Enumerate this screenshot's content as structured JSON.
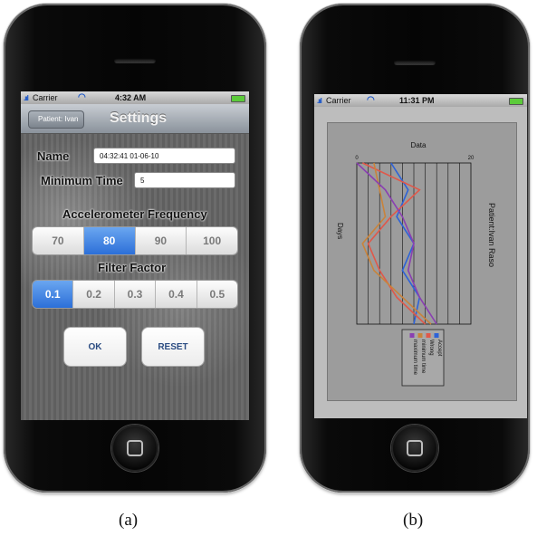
{
  "captions": {
    "a": "(a)",
    "b": "(b)"
  },
  "colors": {
    "accent": "#2c6fd8",
    "series": [
      "#2d62d8",
      "#e0584a",
      "#c9833b",
      "#8a3fb2"
    ]
  },
  "screen_a": {
    "status": {
      "carrier": "Carrier",
      "time": "4:32 AM"
    },
    "nav": {
      "back_label": "Patient: Ivan",
      "title": "Settings"
    },
    "name_label": "Name",
    "name_value": "04:32:41 01-06-10",
    "min_time_label": "Minimum Time",
    "min_time_value": "5",
    "accel_label": "Accelerometer Frequency",
    "accel_options": [
      "70",
      "80",
      "90",
      "100"
    ],
    "accel_selected": "80",
    "filter_label": "Filter Factor",
    "filter_options": [
      "0.1",
      "0.2",
      "0.3",
      "0.4",
      "0.5"
    ],
    "filter_selected": "0.1",
    "ok_label": "OK",
    "reset_label": "RESET"
  },
  "screen_b": {
    "status": {
      "carrier": "Carrier",
      "time": "11:31 PM"
    }
  },
  "chart_data": {
    "type": "line",
    "title": "Data",
    "xlabel": "Days",
    "ylabel": "",
    "right_label": "Patient:Ivan Raso",
    "xlim": [
      0,
      20
    ],
    "tick_labels": [
      "0",
      "20"
    ],
    "series": [
      {
        "name": "Accept",
        "color": "#2d62d8",
        "x": [
          6,
          9,
          7,
          10,
          8,
          11,
          10
        ],
        "y": [
          0,
          1,
          2,
          3,
          4,
          5,
          6
        ]
      },
      {
        "name": "Wrong",
        "color": "#e0584a",
        "x": [
          1,
          11,
          6,
          2,
          4,
          7,
          12
        ],
        "y": [
          0,
          1,
          2,
          3,
          4,
          5,
          6
        ]
      },
      {
        "name": "minimum time",
        "color": "#c9833b",
        "x": [
          3,
          4,
          5,
          1,
          3,
          8,
          13
        ],
        "y": [
          0,
          1,
          2,
          3,
          4,
          5,
          6
        ]
      },
      {
        "name": "maximum time",
        "color": "#8a3fb2",
        "x": [
          0,
          5,
          8,
          10,
          9,
          11,
          14
        ],
        "y": [
          0,
          1,
          2,
          3,
          4,
          5,
          6
        ]
      }
    ]
  }
}
